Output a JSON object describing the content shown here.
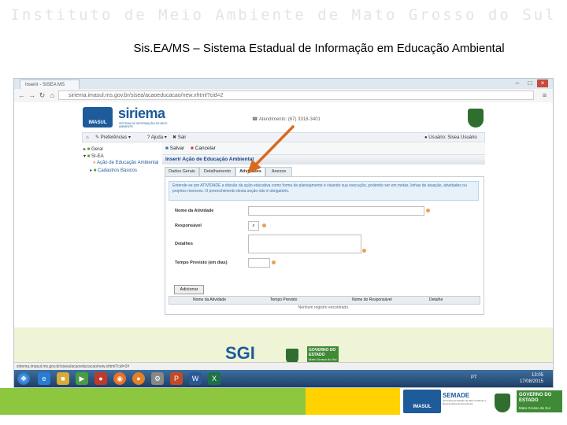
{
  "slide": {
    "header": "Instituto de Meio Ambiente de Mato Grosso do Sul",
    "subtitle": "Sis.EA/MS – Sistema Estadual de Informação em Educação Ambiental"
  },
  "browser": {
    "tab_title": "Inserir - SISEA MS",
    "url": "siriema.imasul.ms.gov.br/sisea/acaoeducacao/new.xhtml?cid=2"
  },
  "app": {
    "logo_text": "IMASUL",
    "brand": "siriema",
    "brand_sub": "SISTEMA DE INFORMAÇÃO DE MEIO AMBIENTE",
    "phone": "Atendimento: (67) 3318-3401",
    "user": "Usuário: Sisea Usuário",
    "menu": {
      "preferencias": "Preferências",
      "ajuda": "Ajuda",
      "sair": "Sair"
    },
    "tree": {
      "root1": "Geral",
      "root2": "SI-EA",
      "item1": "Ação de Educação Ambiental",
      "item2": "Cadastros Básicos"
    },
    "toolbar": {
      "save": "Salvar",
      "cancel": "Cancelar"
    },
    "panel_title": "Inserir Ação de Educação Ambiental",
    "tabs": [
      "Dados Gerais",
      "Detalhamento",
      "Atividades",
      "Anexos"
    ],
    "info": "Entende-se por ATIVIDADE a divisão da ação educativa como forma de planejamento e visando sua execução, podendo ser em metas, linhas de atuação, atividades ou projetos menores. O preenchimento desta seção não é obrigatório.",
    "fields": {
      "nome": "Nome da Atividade",
      "responsavel": "Responsável",
      "detalhes": "Detalhes",
      "prazo": "Tempo Previsto (em dias)"
    },
    "add_button": "Adicionar",
    "grid": {
      "columns": [
        "Nome da Atividade",
        "Tempo Previsto",
        "Nome do Responsável",
        "Detalhe"
      ],
      "empty": "Nenhum registro encontrado."
    },
    "footer": {
      "sgi": "SGI",
      "sgi_sub": "SISTEMA DE GESTÃO INTEGRADA",
      "gov": "GOVERNO DO ESTADO",
      "gov_sub": "Mato Grosso do Sul"
    },
    "status_url": "siriema.imasul.ms.gov.br/sisea/acaoeducacao/new.xhtml?cid=2#",
    "clock_time": "13:05",
    "clock_date": "17/08/2015",
    "lang": "PT"
  },
  "slide_footer": {
    "imasul": "IMASUL",
    "semade": "SEMADE",
    "semade_sub": "Secretaria de Estado de Meio Ambiente e Desenvolvimento Econômico",
    "gov": "GOVERNO DO ESTADO",
    "gov_sub": "Mato Grosso do Sul"
  },
  "colors": {
    "brand_blue": "#1d5b9a",
    "arrow": "#d96a1e",
    "footer_green": "#8dc63f",
    "footer_yellow": "#ffd200"
  }
}
